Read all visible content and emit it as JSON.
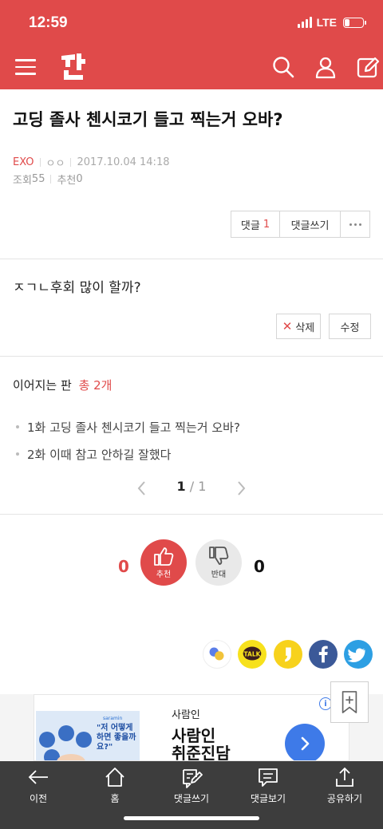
{
  "status": {
    "time": "12:59",
    "network": "LTE",
    "battery_level": 0.3
  },
  "appbar": {
    "logo_icon": "pann-logo",
    "search_icon": "search-icon",
    "user_icon": "user-icon",
    "write_icon": "write-icon"
  },
  "post": {
    "title": "고딩 졸사 첸시코기 들고 찍는거 오바?",
    "category": "EXO",
    "author": "ㅇㅇ",
    "date": "2017.10.04 14:18",
    "views_label": "조회",
    "views": "55",
    "recommend_label": "추천",
    "recommend": "0",
    "body": "ㅈㄱㄴ후회 많이 할까?"
  },
  "actions": {
    "comments_label": "댓글",
    "comments_count": "1",
    "write_comment": "댓글쓰기",
    "delete": "삭제",
    "edit": "수정"
  },
  "series": {
    "title": "이어지는 판",
    "total": "총 2개",
    "items": [
      "1화 고딩 졸사 첸시코기 들고 찍는거 오바?",
      "2화 이때 참고 안하길 잘했다"
    ],
    "page_current": "1",
    "page_sep": "/",
    "page_total": "1"
  },
  "vote": {
    "up_count": "0",
    "up_label": "추천",
    "down_label": "반대",
    "down_count": "0"
  },
  "share_icons": [
    "kakaostory-icon",
    "kakaotalk-icon",
    "story-icon",
    "facebook-icon",
    "twitter-icon"
  ],
  "share": {
    "talk_label": "TALK"
  },
  "ad": {
    "brand": "사람인",
    "name_line1": "사람인",
    "name_line2": "취준진담",
    "image_header": "saramin",
    "image_text": "\"저 어떻게 하면 좋을까요?\"",
    "info": "i"
  },
  "colors": {
    "brand": "#e04a4a",
    "nav_bg": "#3d3d3d",
    "ad_blue": "#3e7ae8"
  },
  "bottom_nav": [
    {
      "label": "이전",
      "icon": "back-arrow-icon"
    },
    {
      "label": "홈",
      "icon": "home-icon"
    },
    {
      "label": "댓글쓰기",
      "icon": "edit-comment-icon"
    },
    {
      "label": "댓글보기",
      "icon": "comment-view-icon"
    },
    {
      "label": "공유하기",
      "icon": "share-icon"
    }
  ]
}
